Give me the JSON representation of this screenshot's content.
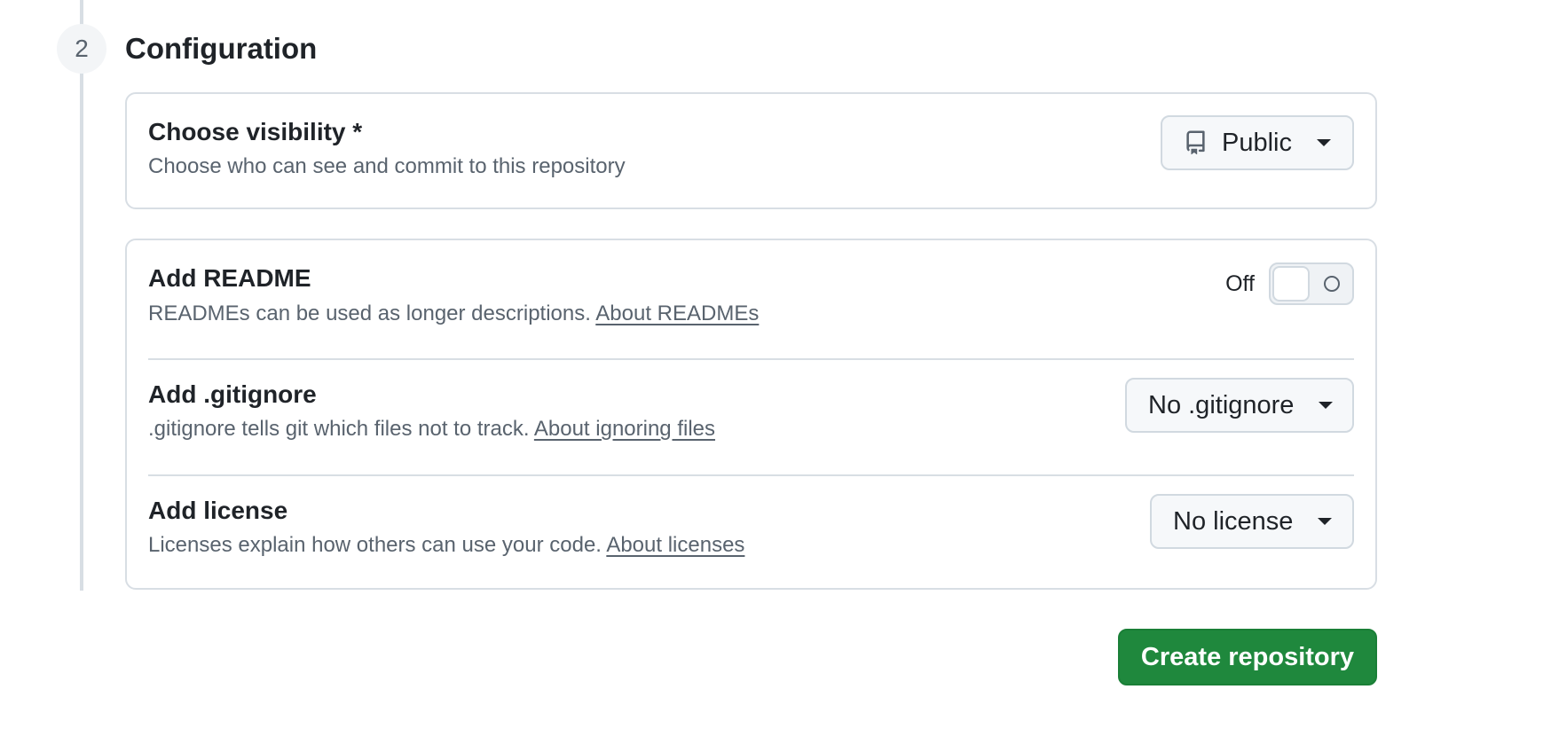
{
  "step": {
    "number": "2",
    "title": "Configuration"
  },
  "visibility": {
    "title": "Choose visibility *",
    "description": "Choose who can see and commit to this repository",
    "selected": "Public",
    "icon": "repo-icon"
  },
  "readme": {
    "title": "Add README",
    "description": "READMEs can be used as longer descriptions.",
    "link": "About READMEs",
    "toggle_label": "Off",
    "enabled": false
  },
  "gitignore": {
    "title": "Add .gitignore",
    "description": ".gitignore tells git which files not to track.",
    "link": "About ignoring files",
    "selected": "No .gitignore"
  },
  "license": {
    "title": "Add license",
    "description": "Licenses explain how others can use your code.",
    "link": "About licenses",
    "selected": "No license"
  },
  "actions": {
    "create_label": "Create repository"
  },
  "colors": {
    "primary_button": "#1f883d",
    "border": "#d8dee4",
    "muted_text": "#59636e"
  }
}
